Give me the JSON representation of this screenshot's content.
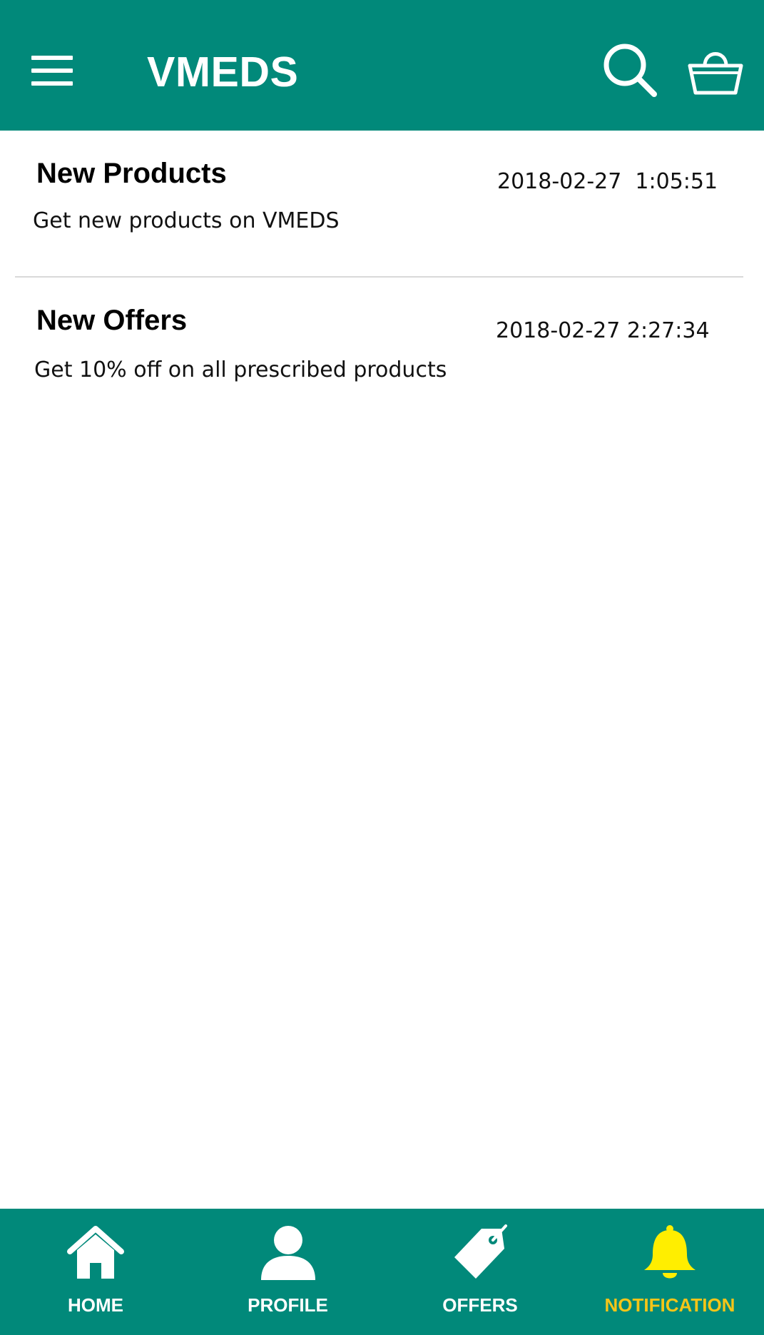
{
  "app_bar": {
    "title": "VMEDS",
    "menu_icon": "hamburger-menu-icon",
    "search_icon": "search-icon",
    "cart_icon": "shopping-basket-icon",
    "background_color": "#01897a"
  },
  "notifications": [
    {
      "title": "New Products",
      "timestamp": "2018-02-27  1:05:51",
      "body": "Get new products on VMEDS"
    },
    {
      "title": "New Offers",
      "timestamp": "2018-02-27 2:27:34",
      "body": "Get 10% off on all prescribed products"
    }
  ],
  "bottom_nav": {
    "background_color": "#01897a",
    "active_color": "#f5c518",
    "items": [
      {
        "label": "HOME",
        "icon": "home-icon",
        "active": false
      },
      {
        "label": "PROFILE",
        "icon": "user-icon",
        "active": false
      },
      {
        "label": "OFFERS",
        "icon": "tag-icon",
        "active": false
      },
      {
        "label": "NOTIFICATION",
        "icon": "bell-icon",
        "active": true
      }
    ]
  }
}
